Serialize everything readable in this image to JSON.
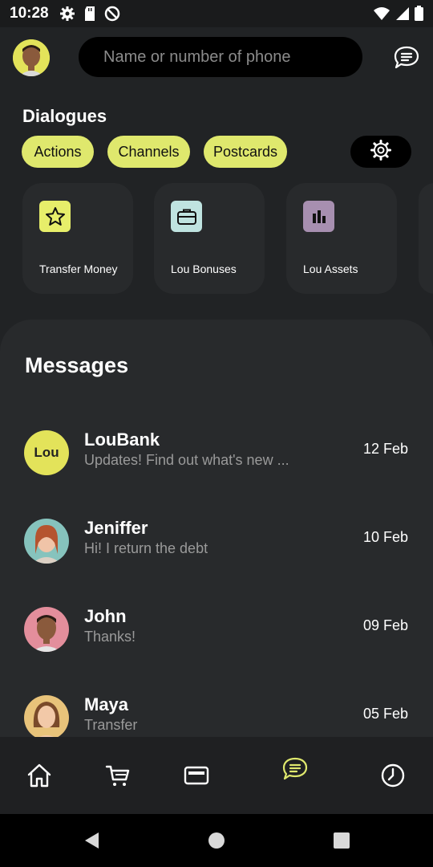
{
  "status_bar": {
    "time": "10:28",
    "left_icons": [
      "settings-icon",
      "sd-card-icon",
      "at-sign-icon"
    ],
    "right_icons": [
      "wifi-icon",
      "signal-icon",
      "battery-icon"
    ]
  },
  "header": {
    "search_placeholder": "Name or number of phone",
    "chat_icon": "chat-bubble-icon"
  },
  "dialogues": {
    "title": "Dialogues",
    "chips": [
      "Actions",
      "Channels",
      "Postcards"
    ],
    "settings_icon": "gear-icon"
  },
  "quick_actions": [
    {
      "label": "Transfer Money",
      "icon": "star-icon",
      "icon_bg": "#e7ee6a"
    },
    {
      "label": "Lou Bonuses",
      "icon": "briefcase-icon",
      "icon_bg": "#bfe3e0"
    },
    {
      "label": "Lou Assets",
      "icon": "bar-chart-icon",
      "icon_bg": "#a78fb0"
    }
  ],
  "messages": {
    "title": "Messages",
    "items": [
      {
        "name": "LouBank",
        "preview": "Updates! Find out what's new ...",
        "date": "12 Feb",
        "avatar_text": "Lou"
      },
      {
        "name": "Jeniffer",
        "preview": "Hi! I return the debt",
        "date": "10 Feb"
      },
      {
        "name": "John",
        "preview": "Thanks!",
        "date": "09 Feb"
      },
      {
        "name": "Maya",
        "preview": "Transfer",
        "date": "05 Feb"
      }
    ]
  },
  "bottom_nav": {
    "items": [
      "home-icon",
      "cart-icon",
      "card-icon",
      "chat-icon",
      "history-icon"
    ],
    "active": "chat-icon"
  },
  "colors": {
    "accent": "#dfe86d",
    "background": "#212325",
    "panel": "#282a2c",
    "muted_text": "#9a9a9a"
  }
}
